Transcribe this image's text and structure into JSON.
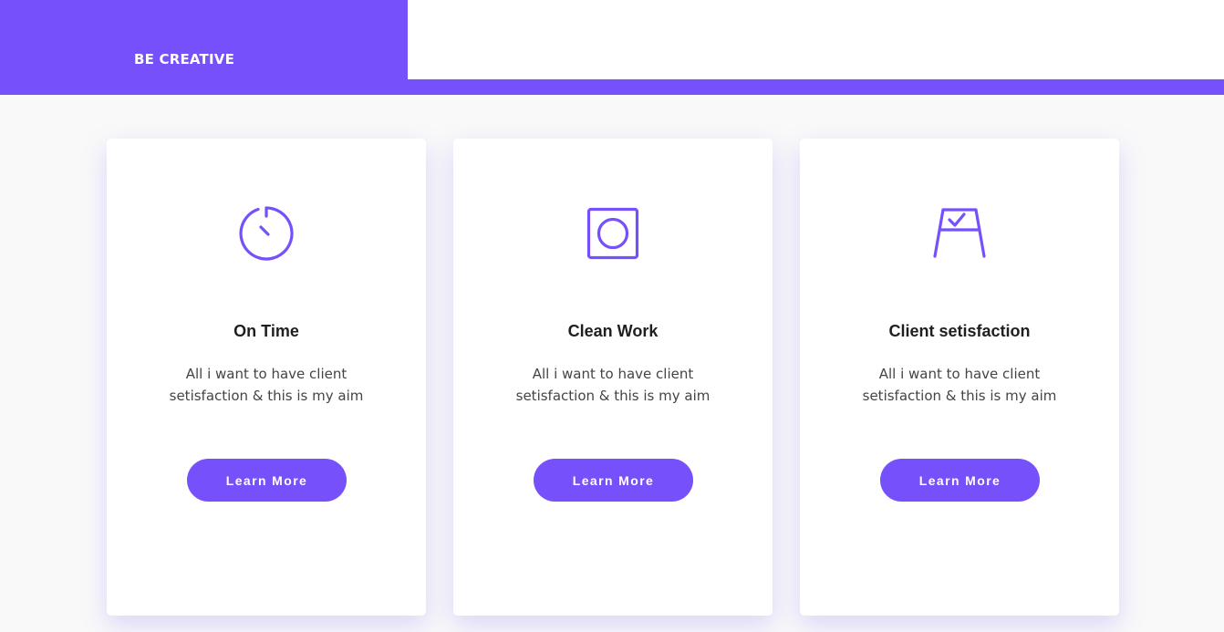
{
  "header": {
    "brand": "BE CREATIVE",
    "accent_color": "#7650fb"
  },
  "cards": [
    {
      "icon": "stopwatch-icon",
      "title": "On Time",
      "description": "All i want to have client setisfaction & this is my aim",
      "button_label": "Learn More"
    },
    {
      "icon": "square-circle-icon",
      "title": "Clean Work",
      "description": "All i want to have client setisfaction & this is my aim",
      "button_label": "Learn More"
    },
    {
      "icon": "easel-check-icon",
      "title": "Client setisfaction",
      "description": "All i want to have client setisfaction & this is my aim",
      "button_label": "Learn More"
    }
  ]
}
